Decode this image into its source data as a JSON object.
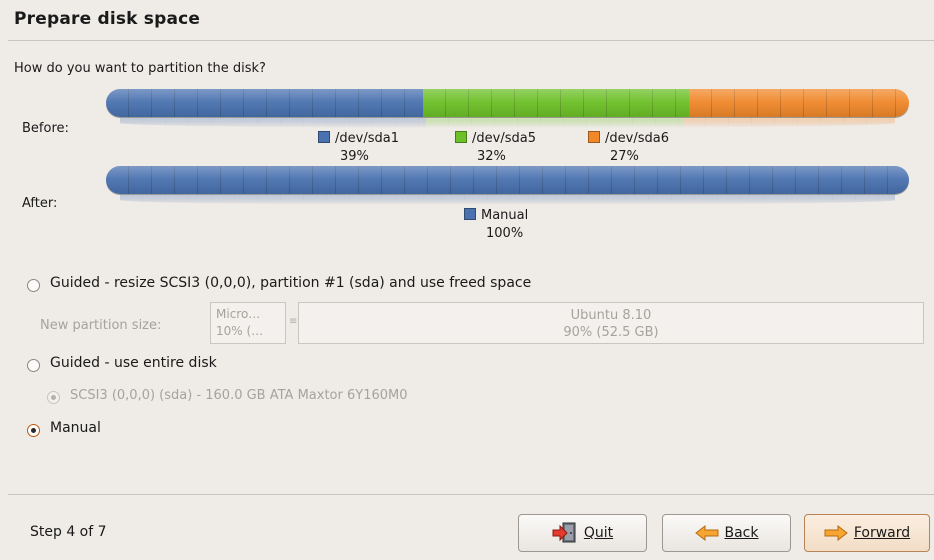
{
  "page": {
    "title": "Prepare disk space",
    "question": "How do you want to partition the disk?"
  },
  "before": {
    "label": "Before:",
    "partitions": [
      {
        "name": "/dev/sda1",
        "percent": "39%",
        "fraction": 0.395,
        "color": "#4a72b0"
      },
      {
        "name": "/dev/sda5",
        "percent": "32%",
        "fraction": 0.331,
        "color": "#6dc027"
      },
      {
        "name": "/dev/sda6",
        "percent": "27%",
        "fraction": 0.274,
        "color": "#f0882a"
      }
    ]
  },
  "after": {
    "label": "After:",
    "partitions": [
      {
        "name": "Manual",
        "percent": "100%",
        "fraction": 1.0,
        "color": "#4a72b0"
      }
    ]
  },
  "options": {
    "guided_resize": {
      "label": "Guided - resize SCSI3 (0,0,0), partition #1 (sda) and use freed space",
      "selected": false
    },
    "new_partition": {
      "label": "New partition size:",
      "left_line1": "Micro…",
      "left_line2": "10% (…",
      "right_line1": "Ubuntu 8.10",
      "right_line2": "90% (52.5 GB)"
    },
    "guided_entire": {
      "label": "Guided - use entire disk",
      "selected": false
    },
    "disk_choice": {
      "label": "SCSI3 (0,0,0) (sda) - 160.0 GB ATA Maxtor 6Y160M0",
      "selected": true,
      "enabled": false
    },
    "manual": {
      "label": "Manual",
      "selected": true
    }
  },
  "footer": {
    "step": "Step 4 of 7",
    "quit_label": "Quit",
    "back_label": "Back",
    "forward_label": "Forward"
  },
  "icons": {
    "quit": "quit-door-icon",
    "back": "arrow-left-icon",
    "forward": "arrow-right-icon"
  }
}
